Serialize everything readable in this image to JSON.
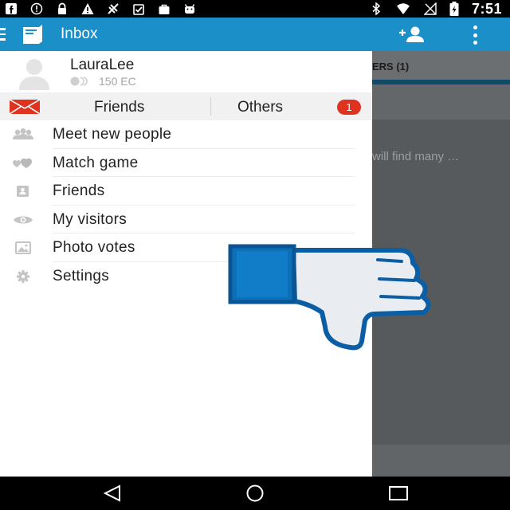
{
  "status_bar": {
    "time": "7:51",
    "icons": [
      "facebook-icon",
      "alert-circle-icon",
      "lock-icon",
      "warning-icon",
      "satellite-icon",
      "clipboard-check-icon",
      "bag-icon",
      "android-icon",
      "bluetooth-icon",
      "wifi-icon",
      "no-signal-icon",
      "battery-charging-icon"
    ]
  },
  "app_bar": {
    "title": "Inbox",
    "color": "#1b8fc7"
  },
  "profile": {
    "username": "LauraLee",
    "credits": "150 EC"
  },
  "drawer_tabs": {
    "friends": "Friends",
    "others": "Others",
    "others_badge": "1"
  },
  "menu": {
    "items": [
      {
        "label": "Meet new people",
        "icon": "people-icon"
      },
      {
        "label": "Match game",
        "icon": "hearts-icon"
      },
      {
        "label": "Friends",
        "icon": "contact-card-icon"
      },
      {
        "label": "My visitors",
        "icon": "eye-icon"
      },
      {
        "label": "Photo votes",
        "icon": "photo-icon"
      },
      {
        "label": "Settings",
        "icon": "gear-icon"
      }
    ]
  },
  "background": {
    "tab_label": "ERS (1)",
    "snippet": "will find many …"
  },
  "colors": {
    "badge": "#e0331f",
    "thumb": "#0c6fb8"
  }
}
